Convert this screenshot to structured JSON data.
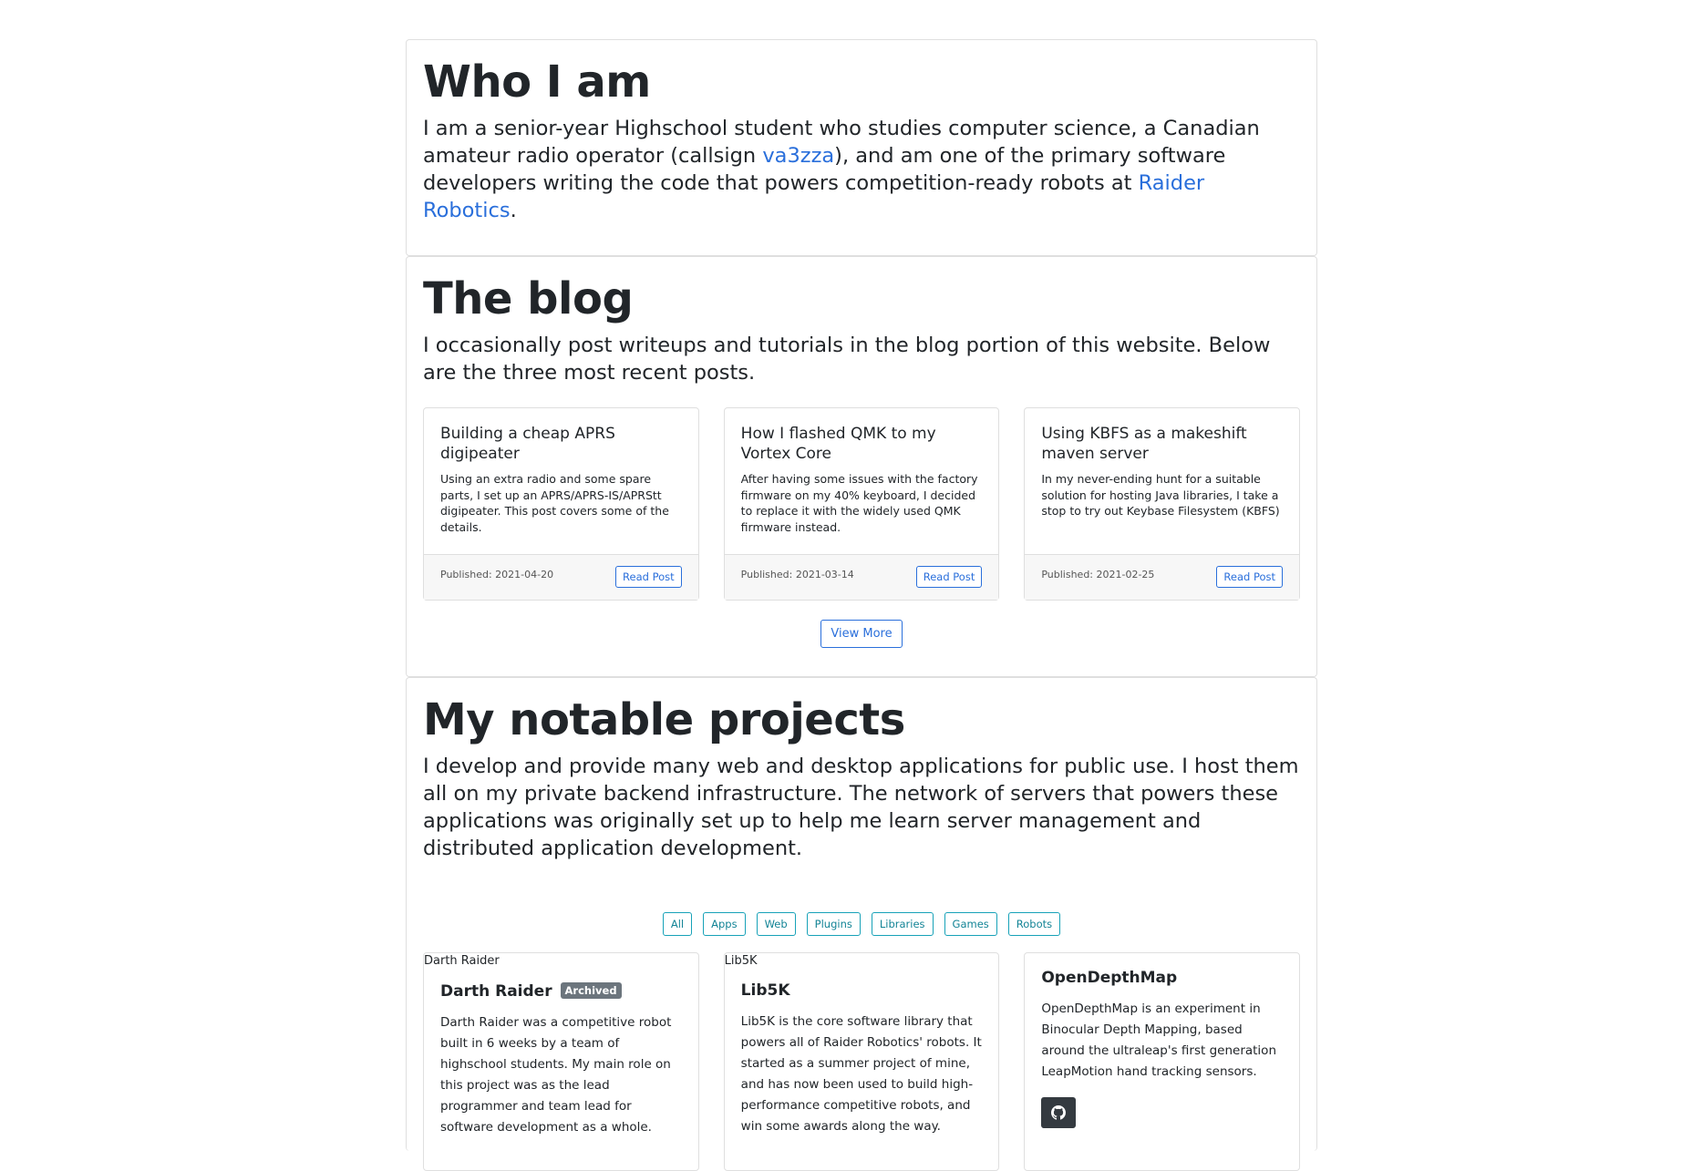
{
  "about": {
    "title": "Who I am",
    "text_1": "I am a senior-year Highschool student who studies computer science, a Canadian amateur radio operator (callsign ",
    "callsign": "va3zza",
    "text_2": "), and am one of the primary software developers writing the code that powers competition-ready robots at ",
    "team": "Raider Robotics",
    "text_3": "."
  },
  "blog": {
    "title": "The blog",
    "text": "I occasionally post writeups and tutorials in the blog portion of this website. Below are the three most recent posts.",
    "read_label": "Read Post",
    "more_label": "View More",
    "posts": [
      {
        "title": "Building a cheap APRS digipeater",
        "summary": "Using an extra radio and some spare parts, I set up an APRS/APRS-IS/APRStt digipeater. This post covers some of the details.",
        "published": "Published: 2021-04-20"
      },
      {
        "title": "How I flashed QMK to my Vortex Core",
        "summary": "After having some issues with the factory firmware on my 40% keyboard, I decided to replace it with the widely used QMK firmware instead.",
        "published": "Published: 2021-03-14"
      },
      {
        "title": "Using KBFS as a makeshift maven server",
        "summary": "In my never-ending hunt for a suitable solution for hosting Java libraries, I take a stop to try out Keybase Filesystem (KBFS)",
        "published": "Published: 2021-02-25"
      }
    ]
  },
  "projects": {
    "title": "My notable projects",
    "text": "I develop and provide many web and desktop applications for public use. I host them all on my private backend infrastructure. The network of servers that powers these applications was originally set up to help me learn server management and distributed application development.",
    "filters": [
      "All",
      "Apps",
      "Web",
      "Plugins",
      "Libraries",
      "Games",
      "Robots"
    ],
    "items": [
      {
        "image_alt": "Darth Raider",
        "name": "Darth Raider",
        "badge": "Archived",
        "text": "Darth Raider was a competitive robot built in 6 weeks by a team of highschool students. My main role on this project was as the lead programmer and team lead for software development as a whole."
      },
      {
        "image_alt": "Lib5K",
        "name": "Lib5K",
        "text": "Lib5K is the core software library that powers all of Raider Robotics' robots. It started as a summer project of mine, and has now been used to build high-performance competitive robots, and win some awards along the way."
      },
      {
        "name": "OpenDepthMap",
        "text": "OpenDepthMap is an experiment in Binocular Depth Mapping, based around the ultraleap's first generation LeapMotion hand tracking sensors.",
        "link_icon": "github-icon"
      }
    ]
  }
}
